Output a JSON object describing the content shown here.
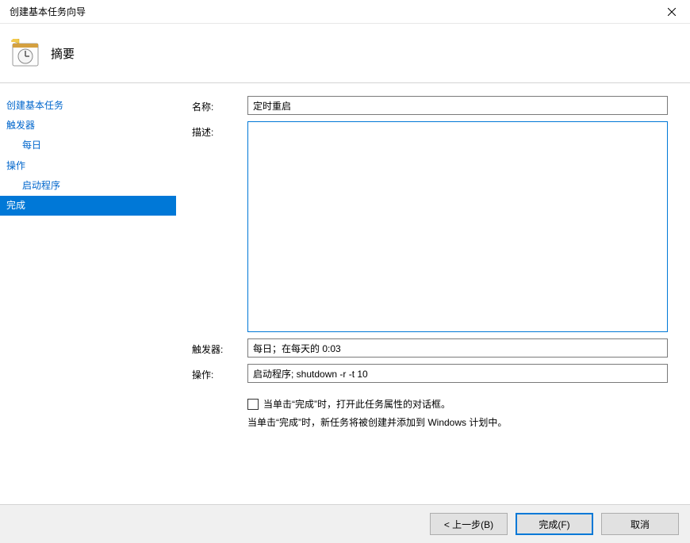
{
  "window": {
    "title": "创建基本任务向导"
  },
  "header": {
    "title": "摘要"
  },
  "sidebar": {
    "items": [
      {
        "label": "创建基本任务",
        "indent": false,
        "selected": false
      },
      {
        "label": "触发器",
        "indent": false,
        "selected": false
      },
      {
        "label": "每日",
        "indent": true,
        "selected": false
      },
      {
        "label": "操作",
        "indent": false,
        "selected": false
      },
      {
        "label": "启动程序",
        "indent": true,
        "selected": false
      },
      {
        "label": "完成",
        "indent": false,
        "selected": true
      }
    ]
  },
  "content": {
    "name_label": "名称:",
    "name_value": "定时重启",
    "desc_label": "描述:",
    "desc_value": "",
    "trigger_label": "触发器:",
    "trigger_value": "每日；在每天的 0:03",
    "action_label": "操作:",
    "action_value": "启动程序; shutdown -r -t 10",
    "checkbox_label": "当单击“完成”时，打开此任务属性的对话框。",
    "hint_text": "当单击“完成”时，新任务将被创建并添加到 Windows 计划中。"
  },
  "footer": {
    "back_label": "< 上一步(B)",
    "finish_label": "完成(F)",
    "cancel_label": "取消"
  }
}
